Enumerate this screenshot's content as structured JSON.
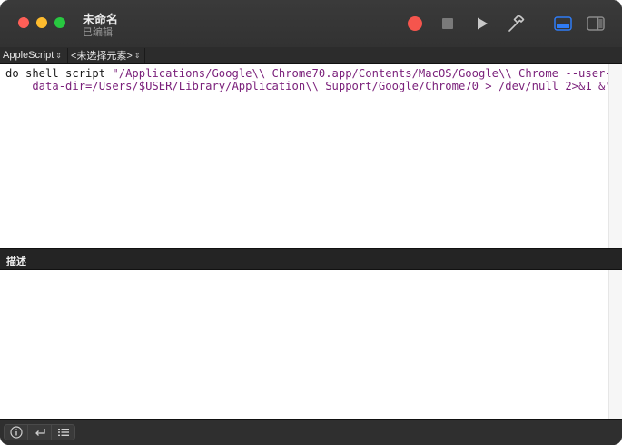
{
  "window": {
    "title": "未命名",
    "subtitle": "已编辑"
  },
  "toolbar": {
    "record_icon": "record-icon",
    "stop_icon": "stop-icon",
    "run_icon": "play-icon",
    "compile_icon": "hammer-icon",
    "show_log_icon": "bottom-panel-icon",
    "show_sidebar_icon": "sidebar-icon"
  },
  "navbar": {
    "language": "AppleScript",
    "element": "<未选择元素>"
  },
  "editor": {
    "line1_prefix": "do shell script ",
    "line1_string": "\"/Applications/Google\\\\ Chrome70.app/Contents/MacOS/Google\\\\ Chrome --user-",
    "line2_string": "    data-dir=/Users/$USER/Library/Application\\\\ Support/Google/Chrome70 > /dev/null 2>&1 &\""
  },
  "description": {
    "label": "描述",
    "text": ""
  },
  "bottombar": {
    "buttons": [
      "info-icon",
      "reply-icon",
      "list-icon"
    ]
  },
  "colors": {
    "titlebar": "#323232",
    "record": "#f5554d",
    "accent": "#2f7cf6",
    "string": "#7a1f7a"
  }
}
